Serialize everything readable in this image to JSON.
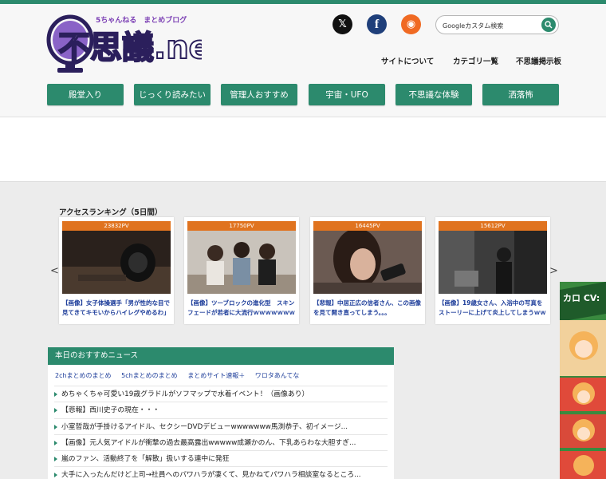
{
  "header": {
    "tagline": "5ちゃんねる　まとめブログ",
    "logo_text": "不思議.net",
    "social": {
      "x": "𝕏",
      "facebook": "f",
      "rss": "◉"
    },
    "search_placeholder": "Googleカスタム検索",
    "nav": [
      "サイトについて",
      "カテゴリ一覧",
      "不思議掲示板"
    ]
  },
  "categories": [
    "殿堂入り",
    "じっくり読みたい",
    "管理人おすすめ",
    "宇宙・UFO",
    "不思議な体験",
    "洒落怖"
  ],
  "ranking": {
    "title": "アクセスランキング（5日間）",
    "prev": "<",
    "next": ">",
    "items": [
      {
        "pv": "23832PV",
        "text": "【画像】女子体操選手「男が性的な目で見てきてキモいからハイレグやめるわ」"
      },
      {
        "pv": "17750PV",
        "text": "【画像】ツーブロックの進化型　スキンフェードが若者に大流行ｗｗｗｗｗｗｗ"
      },
      {
        "pv": "16445PV",
        "text": "【悲報】中居正広の信者さん、この画像を見て開き直ってしまう。。。"
      },
      {
        "pv": "15612PV",
        "text": "【画像】19歳女さん、入浴中の写真をストーリーに上げて炎上してしまうｗｗ"
      }
    ]
  },
  "news": {
    "title": "本日のおすすめニュース",
    "links": [
      "2chまとめのまとめ",
      "5chまとめのまとめ",
      "まとめサイト速報＋",
      "ワロタあんてな"
    ],
    "items": [
      "めちゃくちゃ可愛い19歳グラドルがソフマップで水着イベント！（画像あり）",
      "【悲報】西川史子の現在・・・",
      "小室哲哉が手掛けるアイドル、セクシーDVDデビューwwwwwww馬渕恭子、初イメージ...",
      "【画像】元人気アイドルが衝撃の過去最高露出wwwww成瀬かのん、下乳あらわな大胆すぎ...",
      "嵐のファン、活動終了を「解散」扱いする連中に発狂",
      "大手に入ったんだけど上司→社員へのパワハラが凄くて、見かねてパワハラ相談室なるところ..."
    ]
  },
  "side_ad": {
    "text": "カロ CV:"
  }
}
